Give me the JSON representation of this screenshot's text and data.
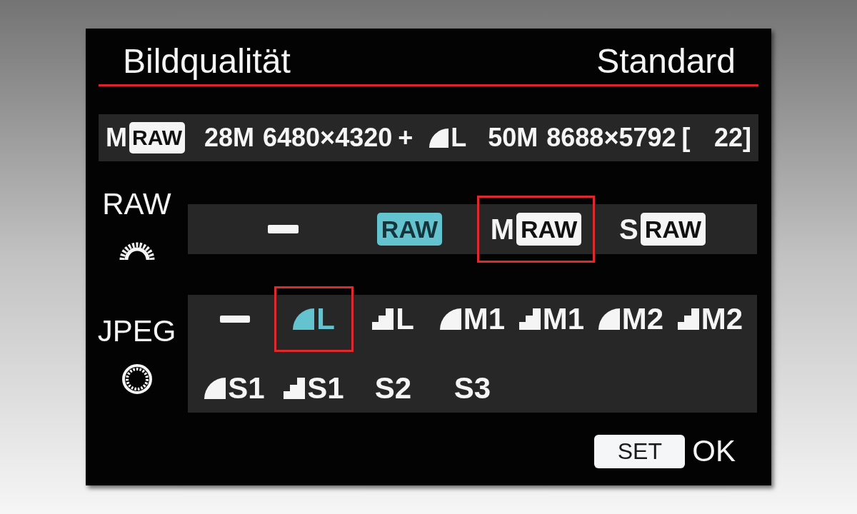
{
  "header": {
    "title": "Bildqualität",
    "value": "Standard"
  },
  "summary": {
    "raw_prefix": "M",
    "raw_badge": "RAW",
    "raw_megapixels": "28M",
    "raw_resolution": "6480×4320",
    "plus": "+",
    "jpeg": {
      "kind": "fine",
      "size": "L"
    },
    "jpeg_megapixels": "50M",
    "jpeg_resolution": "8688×5792",
    "bracket": "[",
    "shots": "22]"
  },
  "raw_row": {
    "label": "RAW",
    "options": [
      {
        "kind": "none",
        "selected": false,
        "highlighted": false
      },
      {
        "kind": "raw",
        "badge": "RAW",
        "selected": false,
        "highlighted": true
      },
      {
        "kind": "raw",
        "prefix": "M",
        "badge": "RAW",
        "selected": true,
        "highlighted": false
      },
      {
        "kind": "raw",
        "prefix": "S",
        "badge": "RAW",
        "selected": false,
        "highlighted": false
      }
    ]
  },
  "jpeg_row": {
    "label": "JPEG",
    "options": [
      {
        "kind": "none",
        "selected": false,
        "highlighted": false
      },
      {
        "kind": "fine",
        "size": "L",
        "selected": true,
        "highlighted": true
      },
      {
        "kind": "normal",
        "size": "L",
        "selected": false,
        "highlighted": false
      },
      {
        "kind": "fine",
        "size": "M1",
        "selected": false,
        "highlighted": false
      },
      {
        "kind": "normal",
        "size": "M1",
        "selected": false,
        "highlighted": false
      },
      {
        "kind": "fine",
        "size": "M2",
        "selected": false,
        "highlighted": false
      },
      {
        "kind": "normal",
        "size": "M2",
        "selected": false,
        "highlighted": false
      },
      {
        "kind": "fine",
        "size": "S1",
        "selected": false,
        "highlighted": false
      },
      {
        "kind": "normal",
        "size": "S1",
        "selected": false,
        "highlighted": false
      },
      {
        "kind": "plain",
        "size": "S2",
        "selected": false,
        "highlighted": false
      },
      {
        "kind": "plain",
        "size": "S3",
        "selected": false,
        "highlighted": false
      }
    ]
  },
  "footer": {
    "key": "SET",
    "label": "OK"
  }
}
